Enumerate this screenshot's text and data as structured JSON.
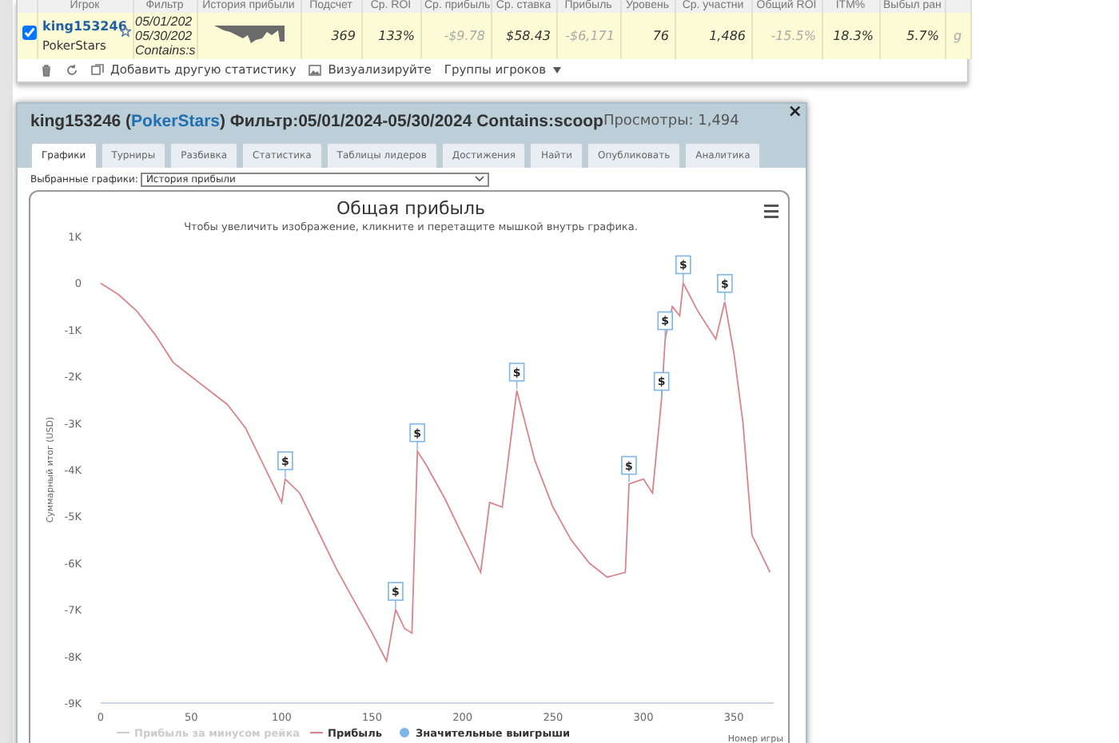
{
  "stats_table": {
    "columns": [
      "Игрок",
      "Фильтр",
      "История прибыли",
      "Подсчет",
      "Ср. ROI",
      "Ср. прибыль",
      "Ср. ставка",
      "Прибыль",
      "Уровень",
      "Ср. участни",
      "Общий ROI",
      "ITM%",
      "Выбыл ран"
    ],
    "rows": [
      {
        "selected": true,
        "player": "king153246",
        "site": "PokerStars",
        "filter": [
          "05/01/202",
          "05/30/202",
          "Contains:s"
        ],
        "stats": [
          {
            "value": "369",
            "muted": false
          },
          {
            "value": "133%",
            "muted": false
          },
          {
            "value": "-$9.78",
            "muted": true
          },
          {
            "value": "$58.43",
            "muted": false
          },
          {
            "value": "-$6,171",
            "muted": true
          },
          {
            "value": "76",
            "muted": false
          },
          {
            "value": "1,486",
            "muted": false
          },
          {
            "value": "-15.5%",
            "muted": true
          },
          {
            "value": "18.3%",
            "muted": false
          },
          {
            "value": "5.7%",
            "muted": false
          },
          {
            "value": "g",
            "muted": true
          }
        ]
      }
    ]
  },
  "table_toolbar": [
    {
      "kind": "trash"
    },
    {
      "kind": "refresh"
    },
    {
      "kind": "add",
      "label": "Добавить другую статистику"
    },
    {
      "kind": "image",
      "label": "Визуализируйте"
    },
    {
      "kind": "dropdown",
      "label": "Группы игроков"
    }
  ],
  "dialog": {
    "title": {
      "player": "king153246 (",
      "site": "PokerStars",
      "filter": ") Фильтр:05/01/2024-05/30/2024 Contains:scoop"
    },
    "views": "Просмотры: 1,494",
    "close": "×",
    "tabs": [
      {
        "label": "Графики",
        "selected": true
      },
      {
        "label": "Турниры",
        "selected": false
      },
      {
        "label": "Разбивка",
        "selected": false
      },
      {
        "label": "Статистика",
        "selected": false
      },
      {
        "label": "Таблицы лидеров",
        "selected": false
      },
      {
        "label": "Достижения",
        "selected": false
      },
      {
        "label": "Найти",
        "selected": false
      },
      {
        "label": "Опубликовать",
        "selected": false
      },
      {
        "label": "Аналитика",
        "selected": false
      }
    ],
    "chart_select": {
      "label": "Выбранные графики:",
      "value": "История прибыли"
    },
    "chart": {
      "subtitle": "Чтобы увеличить изображение, кликните и перетащите мышкой внутрь графика.",
      "legend": [
        {
          "label": "Прибыль за минусом рейка",
          "kind": "line",
          "enabled": false
        },
        {
          "kind": "series",
          "enabled": true
        },
        {
          "label": "Значительные выигрыши",
          "kind": "dot",
          "enabled": true,
          "color": "#7cb5ec"
        }
      ],
      "chart_data": {
        "type": "line",
        "title": "Общая прибыль",
        "xlabel": "Номер игры",
        "ylabel": "Суммарный итог (USD)",
        "x": [
          0,
          10,
          20,
          30,
          40,
          50,
          60,
          70,
          80,
          90,
          100,
          102,
          110,
          120,
          130,
          140,
          150,
          158,
          163,
          168,
          172,
          175,
          180,
          190,
          200,
          210,
          215,
          222,
          230,
          240,
          250,
          260,
          270,
          280,
          290,
          292,
          300,
          305,
          310,
          312,
          316,
          320,
          322,
          330,
          340,
          345,
          350,
          355,
          360,
          365,
          370
        ],
        "series": [
          {
            "name": "Прибыль",
            "color": "#d9848c",
            "values": [
              0,
              -250,
              -600,
              -1100,
              -1700,
              -2000,
              -2300,
              -2600,
              -3100,
              -3900,
              -4700,
              -4200,
              -4500,
              -5300,
              -6100,
              -6800,
              -7500,
              -8100,
              -7000,
              -7400,
              -7500,
              -3600,
              -3900,
              -4600,
              -5400,
              -6200,
              -4700,
              -4800,
              -2300,
              -3800,
              -4800,
              -5500,
              -6000,
              -6300,
              -6200,
              -4300,
              -4200,
              -4500,
              -2500,
              -1200,
              -500,
              -700,
              0,
              -600,
              -1200,
              -400,
              -1500,
              -3000,
              -5400,
              -5800,
              -6200
            ]
          }
        ],
        "xlim": [
          0,
          372
        ],
        "ylim": [
          -9000,
          1000
        ],
        "xticks": [
          0,
          50,
          100,
          150,
          200,
          250,
          300,
          350
        ],
        "yticks": [
          {
            "value": 1000,
            "label": "1K"
          },
          {
            "value": 0,
            "label": "0"
          },
          {
            "value": -1000,
            "label": "-1K"
          },
          {
            "value": -2000,
            "label": "-2K"
          },
          {
            "value": -3000,
            "label": "-3K"
          },
          {
            "value": -4000,
            "label": "-4K"
          },
          {
            "value": -5000,
            "label": "-5K"
          },
          {
            "value": -6000,
            "label": "-6K"
          },
          {
            "value": -7000,
            "label": "-7K"
          },
          {
            "value": -8000,
            "label": "-8K"
          },
          {
            "value": -9000,
            "label": "-9K"
          }
        ],
        "annotations": [
          {
            "x": 102,
            "y": -4200,
            "text": "$"
          },
          {
            "x": 163,
            "y": -7000,
            "text": "$"
          },
          {
            "x": 175,
            "y": -3600,
            "text": "$"
          },
          {
            "x": 230,
            "y": -2300,
            "text": "$"
          },
          {
            "x": 292,
            "y": -4300,
            "text": "$"
          },
          {
            "x": 310,
            "y": -2500,
            "text": "$"
          },
          {
            "x": 312,
            "y": -1200,
            "text": "$"
          },
          {
            "x": 322,
            "y": 0,
            "text": "$"
          },
          {
            "x": 345,
            "y": -400,
            "text": "$"
          }
        ]
      }
    }
  }
}
